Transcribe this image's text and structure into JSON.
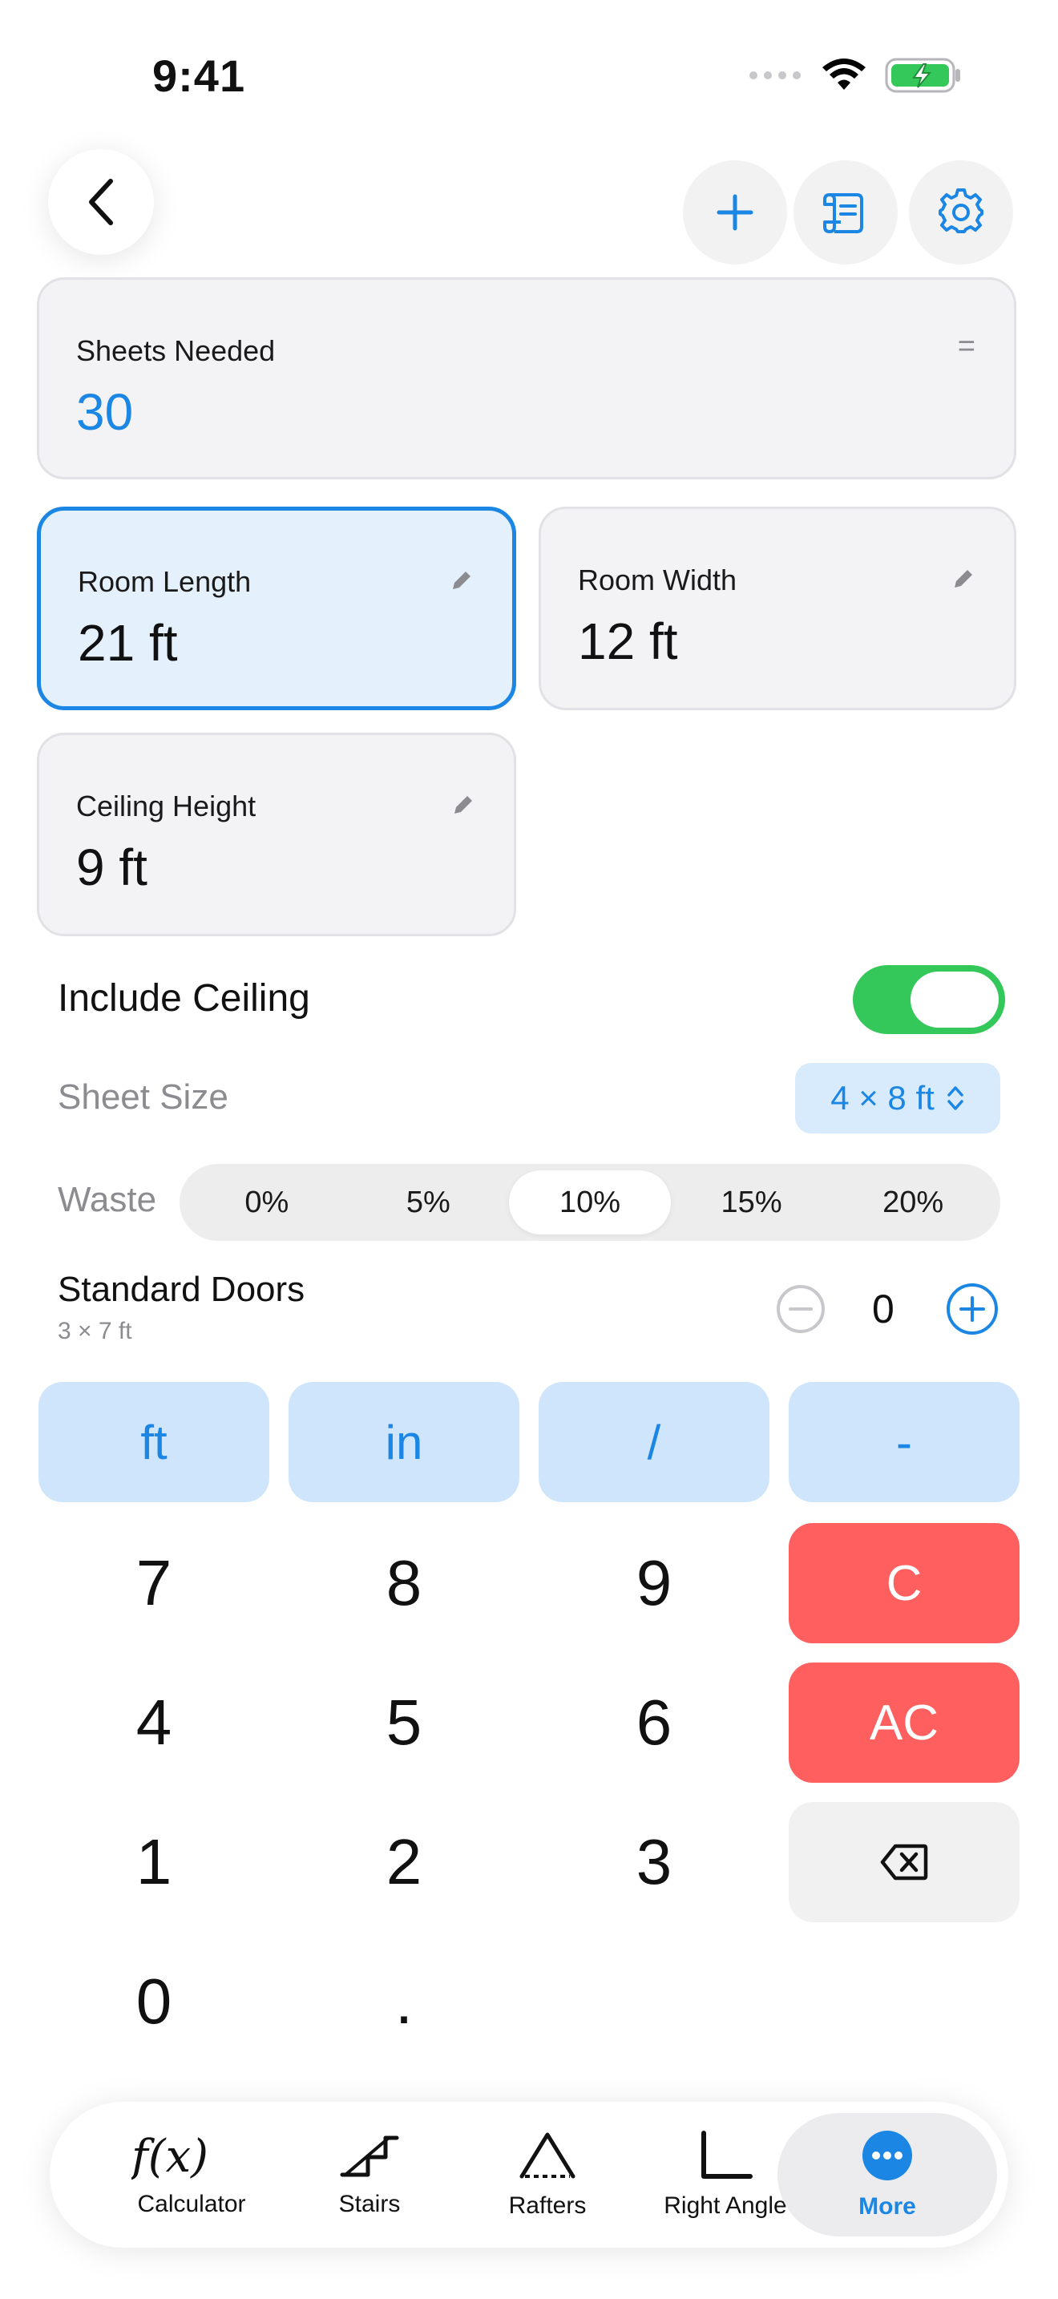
{
  "status_bar": {
    "time": "9:41"
  },
  "result_card": {
    "label": "Sheets Needed",
    "value": "30",
    "corner_symbol": "="
  },
  "inputs": {
    "room_length": {
      "label": "Room Length",
      "value": "21 ft"
    },
    "room_width": {
      "label": "Room Width",
      "value": "12 ft"
    },
    "ceiling_height": {
      "label": "Ceiling Height",
      "value": "9 ft"
    }
  },
  "options": {
    "include_ceiling": {
      "label": "Include Ceiling",
      "on": true
    },
    "sheet_size": {
      "label": "Sheet Size",
      "value": "4 × 8 ft"
    },
    "waste": {
      "label": "Waste",
      "options": [
        "0%",
        "5%",
        "10%",
        "15%",
        "20%"
      ],
      "selected": "10%"
    },
    "doors": {
      "label": "Standard Doors",
      "sublabel": "3 × 7 ft",
      "count": "0"
    }
  },
  "keypad": {
    "units": [
      "ft",
      "in",
      "/",
      "-"
    ],
    "rows": [
      [
        "7",
        "8",
        "9"
      ],
      [
        "4",
        "5",
        "6"
      ],
      [
        "1",
        "2",
        "3"
      ],
      [
        "0",
        "."
      ]
    ],
    "clear": "C",
    "all_clear": "AC"
  },
  "tabbar": {
    "tabs": [
      {
        "label": "Calculator",
        "icon": "function-icon"
      },
      {
        "label": "Stairs",
        "icon": "stairs-icon"
      },
      {
        "label": "Rafters",
        "icon": "rafters-icon"
      },
      {
        "label": "Right Angle",
        "icon": "right-angle-icon"
      },
      {
        "label": "More",
        "icon": "more-icon",
        "active": true
      }
    ]
  },
  "colors": {
    "accent": "#1b86e3",
    "danger": "#ff5f5f",
    "toggle_on": "#34c759"
  }
}
